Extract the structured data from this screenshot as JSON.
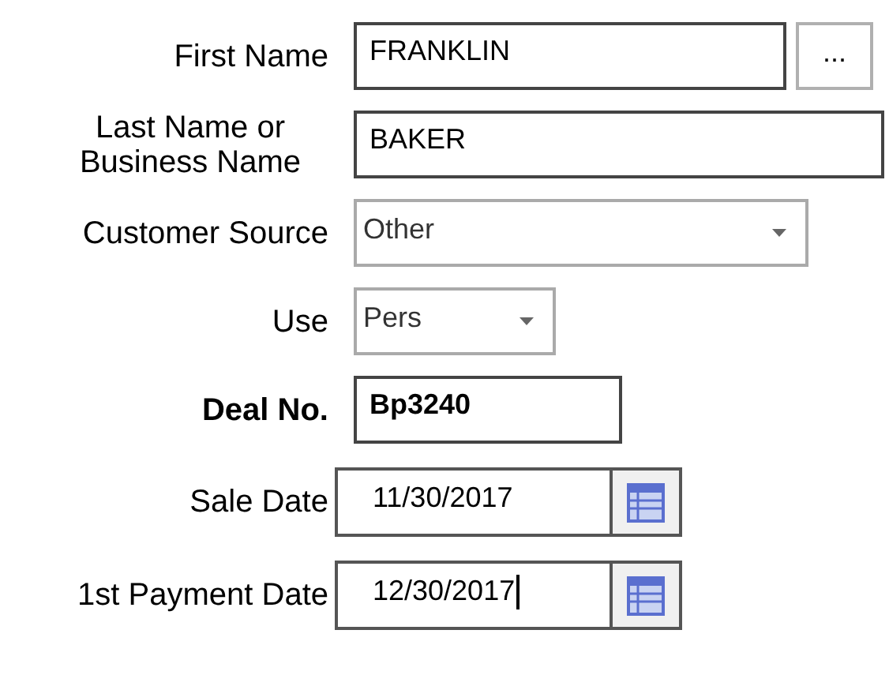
{
  "fields": [
    {
      "kind": "text",
      "label": "First Name",
      "bold": false,
      "value": "FRANKLIN",
      "button": "...",
      "focused": false
    },
    {
      "kind": "text",
      "label": "Last Name or Business Name",
      "bold": false,
      "value": "BAKER",
      "focused": false
    },
    {
      "kind": "select",
      "label": "Customer Source",
      "bold": false,
      "value": "Other"
    },
    {
      "kind": "select",
      "label": "Use",
      "bold": false,
      "value": "Pers"
    },
    {
      "kind": "text",
      "label": "Deal No.",
      "bold": true,
      "value": "Bp3240",
      "focused": false
    },
    {
      "kind": "date",
      "label": "Sale Date",
      "bold": false,
      "value": "11/30/2017",
      "focused": false
    },
    {
      "kind": "date",
      "label": "1st Payment Date",
      "bold": false,
      "value": "12/30/2017",
      "focused": true
    }
  ]
}
